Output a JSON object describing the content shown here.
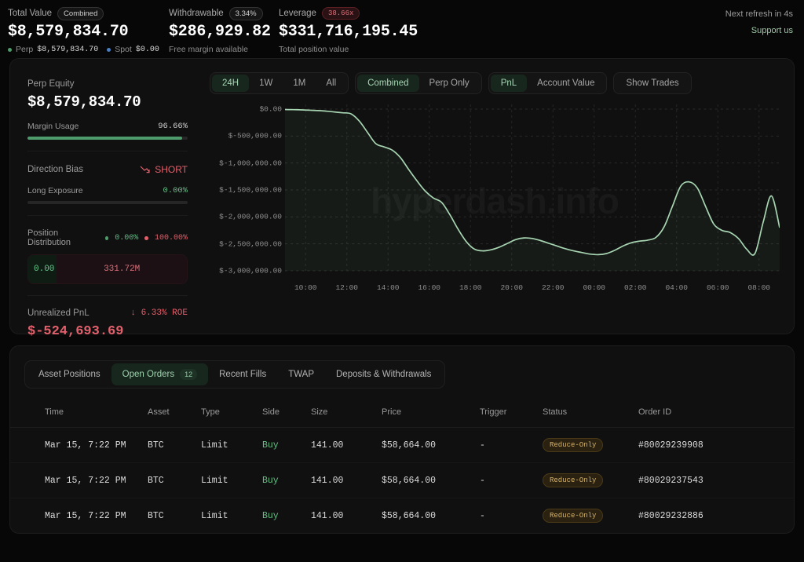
{
  "header": {
    "stats": [
      {
        "label": "Total Value",
        "pill": "Combined",
        "pill_style": "neutral",
        "value": "$8,579,834.70",
        "sub_parts": [
          {
            "dot": "#4e9c6b",
            "label": "Perp",
            "value": "$8,579,834.70"
          },
          {
            "dot": "#4a7fc1",
            "label": "Spot",
            "value": "$0.00"
          }
        ]
      },
      {
        "label": "Withdrawable",
        "pill": "3.34%",
        "pill_style": "neutral",
        "value": "$286,929.82",
        "sub_text": "Free margin available"
      },
      {
        "label": "Leverage",
        "pill": "38.66x",
        "pill_style": "red",
        "value": "$331,716,195.45",
        "sub_text": "Total position value"
      }
    ],
    "refresh_text": "Next refresh in 4s",
    "support_label": "Support us"
  },
  "metrics": {
    "equity_label": "Perp Equity",
    "equity_value": "$8,579,834.70",
    "margin_label": "Margin Usage",
    "margin_value": "96.66%",
    "margin_percent": 96.66,
    "bias_label": "Direction Bias",
    "bias_value": "SHORT",
    "bias_icon": "trend-down-icon",
    "long_exposure_label": "Long Exposure",
    "long_exposure_value": "0.00%",
    "long_exposure_percent": 0,
    "distribution_label": "Position Distribution",
    "distribution_long_pct": "0.00%",
    "distribution_short_pct": "100.00%",
    "distribution_long_value": "0.00",
    "distribution_short_value": "331.72M",
    "pnl_label": "Unrealized PnL",
    "pnl_roe": "↓ 6.33% ROE",
    "pnl_value": "$-524,693.69"
  },
  "chart_toolbar": {
    "ranges": [
      "24H",
      "1W",
      "1M",
      "All"
    ],
    "range_active": "24H",
    "sources": [
      "Combined",
      "Perp Only"
    ],
    "source_active": "Combined",
    "modes": [
      "PnL",
      "Account Value"
    ],
    "mode_active": "PnL",
    "show_trades_label": "Show Trades"
  },
  "chart_data": {
    "type": "area",
    "title": "",
    "xlabel": "",
    "ylabel": "",
    "watermark": "hyperdash.info",
    "grid": true,
    "legend": "none",
    "line_color": "#a7d5b2",
    "fill_color": "rgba(120,180,140,0.07)",
    "ylim": [
      -3000000,
      0
    ],
    "ytick_labels": [
      "$0.00",
      "$-500,000.00",
      "$-1,000,000.00",
      "$-1,500,000.00",
      "$-2,000,000.00",
      "$-2,500,000.00",
      "$-3,000,000.00"
    ],
    "ytick_values": [
      0,
      -500000,
      -1000000,
      -1500000,
      -2000000,
      -2500000,
      -3000000
    ],
    "xtick_labels": [
      "10:00",
      "12:00",
      "14:00",
      "16:00",
      "18:00",
      "20:00",
      "22:00",
      "00:00",
      "02:00",
      "04:00",
      "06:00",
      "08:00"
    ],
    "series": [
      {
        "name": "PnL",
        "x": [
          0,
          1,
          2,
          3,
          4,
          5,
          6,
          7,
          8,
          9,
          10,
          11,
          12,
          13,
          14,
          15,
          16,
          17,
          18,
          19,
          20,
          21,
          22,
          23,
          24,
          25,
          26,
          27,
          28,
          29,
          30,
          31,
          32,
          33,
          34,
          35,
          36,
          37,
          38,
          39,
          40,
          41,
          42,
          43,
          44,
          45,
          46,
          47,
          48,
          49,
          50,
          51,
          52,
          53,
          54,
          55,
          56,
          57,
          58,
          59,
          60
        ],
        "values": [
          -8000,
          -10000,
          -14000,
          -20000,
          -28000,
          -38000,
          -52000,
          -68000,
          -88000,
          -220000,
          -430000,
          -640000,
          -700000,
          -760000,
          -900000,
          -1120000,
          -1330000,
          -1520000,
          -1650000,
          -1730000,
          -1960000,
          -2230000,
          -2460000,
          -2600000,
          -2630000,
          -2610000,
          -2560000,
          -2490000,
          -2420000,
          -2390000,
          -2400000,
          -2440000,
          -2490000,
          -2540000,
          -2590000,
          -2630000,
          -2660000,
          -2690000,
          -2700000,
          -2680000,
          -2620000,
          -2540000,
          -2480000,
          -2450000,
          -2430000,
          -2380000,
          -2180000,
          -1800000,
          -1430000,
          -1350000,
          -1460000,
          -1800000,
          -2130000,
          -2250000,
          -2290000,
          -2400000,
          -2600000,
          -2680000,
          -2100000,
          -1610000,
          -2200000
        ]
      }
    ]
  },
  "table": {
    "tabs": [
      {
        "label": "Asset Positions",
        "badge": null,
        "active": false
      },
      {
        "label": "Open Orders",
        "badge": "12",
        "active": true
      },
      {
        "label": "Recent Fills",
        "badge": null,
        "active": false
      },
      {
        "label": "TWAP",
        "badge": null,
        "active": false
      },
      {
        "label": "Deposits & Withdrawals",
        "badge": null,
        "active": false
      }
    ],
    "columns": [
      "Time",
      "Asset",
      "Type",
      "Side",
      "Size",
      "Price",
      "Trigger",
      "Status",
      "Order ID"
    ],
    "rows": [
      {
        "time": "Mar 15, 7:22 PM",
        "asset": "BTC",
        "type": "Limit",
        "side": "Buy",
        "size": "141.00",
        "price": "$58,664.00",
        "trigger": "-",
        "status": "Reduce-Only",
        "order_id": "#80029239908"
      },
      {
        "time": "Mar 15, 7:22 PM",
        "asset": "BTC",
        "type": "Limit",
        "side": "Buy",
        "size": "141.00",
        "price": "$58,664.00",
        "trigger": "-",
        "status": "Reduce-Only",
        "order_id": "#80029237543"
      },
      {
        "time": "Mar 15, 7:22 PM",
        "asset": "BTC",
        "type": "Limit",
        "side": "Buy",
        "size": "141.00",
        "price": "$58,664.00",
        "trigger": "-",
        "status": "Reduce-Only",
        "order_id": "#80029232886"
      }
    ]
  }
}
